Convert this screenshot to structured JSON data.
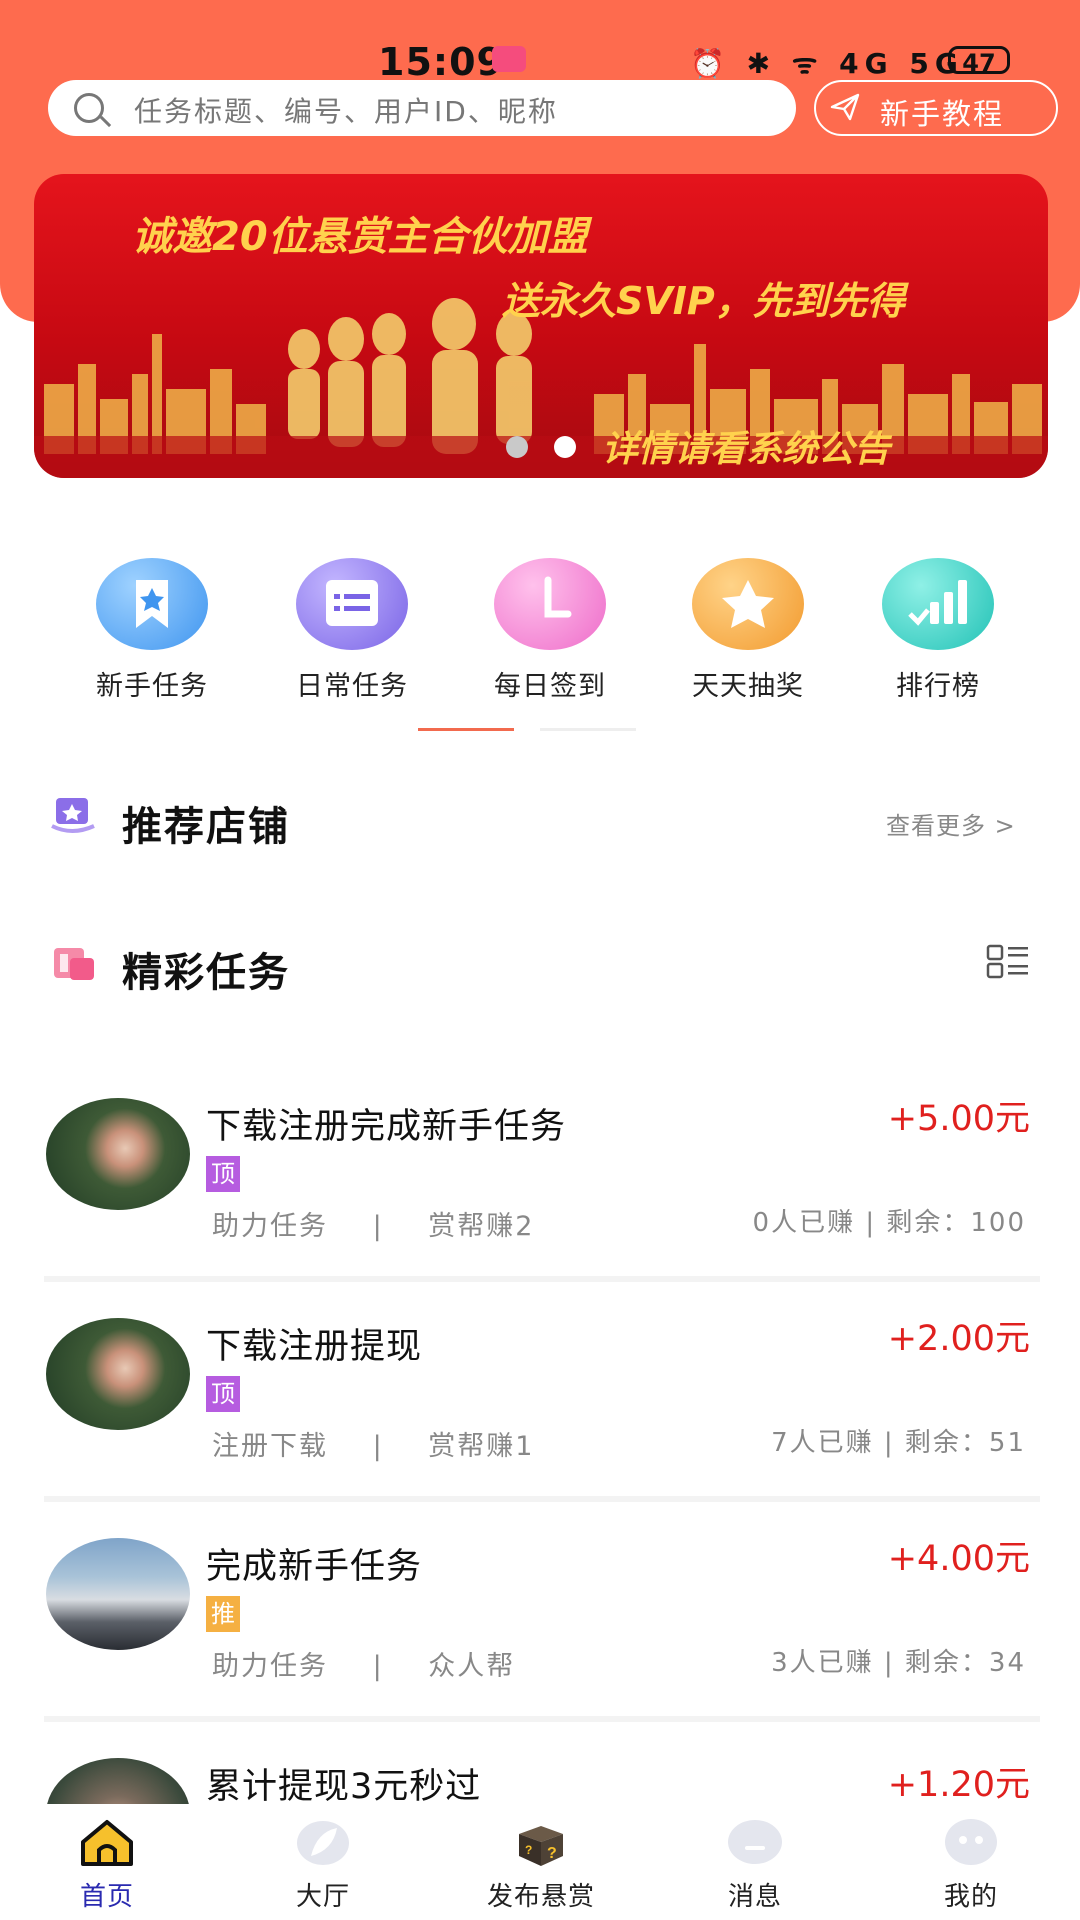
{
  "status_bar": {
    "time": "15:09",
    "icons": "⏰ ✱ ᯤ 4G 5G",
    "battery": "47"
  },
  "search": {
    "placeholder": "任务标题、编号、用户ID、昵称"
  },
  "tutorial_button": {
    "label": "新手教程"
  },
  "banner": {
    "line1": "诚邀20位悬赏主合伙加盟",
    "line2": "送永久SVIP，先到先得",
    "line3": "详情请看系统公告",
    "active_slide": 2,
    "slide_count": 2
  },
  "quick_actions": [
    {
      "label": "新手任务",
      "icon": "bookmark-star-icon",
      "color": "#5aa8f5"
    },
    {
      "label": "日常任务",
      "icon": "calendar-list-icon",
      "color": "#8f7cf0"
    },
    {
      "label": "每日签到",
      "icon": "clock-icon",
      "color": "#f27ed0"
    },
    {
      "label": "天天抽奖",
      "icon": "star-icon",
      "color": "#f7a63a"
    },
    {
      "label": "排行榜",
      "icon": "bar-chart-icon",
      "color": "#36cfc4"
    }
  ],
  "sections": {
    "shops_title": "推荐店铺",
    "shops_more": "查看更多 >",
    "tasks_title": "精彩任务"
  },
  "tasks": [
    {
      "title": "下载注册完成新手任务",
      "price": "+5.00元",
      "tag": "顶",
      "tag_color": "#b65ce0",
      "category": "助力任务",
      "separator": "|",
      "publisher": "赏帮赚2",
      "stats": "0人已赚 | 剩余：100"
    },
    {
      "title": "下载注册提现",
      "price": "+2.00元",
      "tag": "顶",
      "tag_color": "#b65ce0",
      "category": "注册下载",
      "separator": "|",
      "publisher": "赏帮赚1",
      "stats": "7人已赚 | 剩余：51"
    },
    {
      "title": "完成新手任务",
      "price": "+4.00元",
      "tag": "推",
      "tag_color": "#f5b042",
      "category": "助力任务",
      "separator": "|",
      "publisher": "众人帮",
      "stats": "3人已赚 | 剩余：34"
    },
    {
      "title": "累计提现3元秒过",
      "price": "+1.20元"
    }
  ],
  "bottom_nav": [
    {
      "label": "首页",
      "icon": "home-icon",
      "active": true
    },
    {
      "label": "大厅",
      "icon": "leaf-icon",
      "active": false
    },
    {
      "label": "发布悬赏",
      "icon": "mystery-box-icon",
      "active": false
    },
    {
      "label": "消息",
      "icon": "chat-bubble-icon",
      "active": false
    },
    {
      "label": "我的",
      "icon": "user-face-icon",
      "active": false
    }
  ]
}
